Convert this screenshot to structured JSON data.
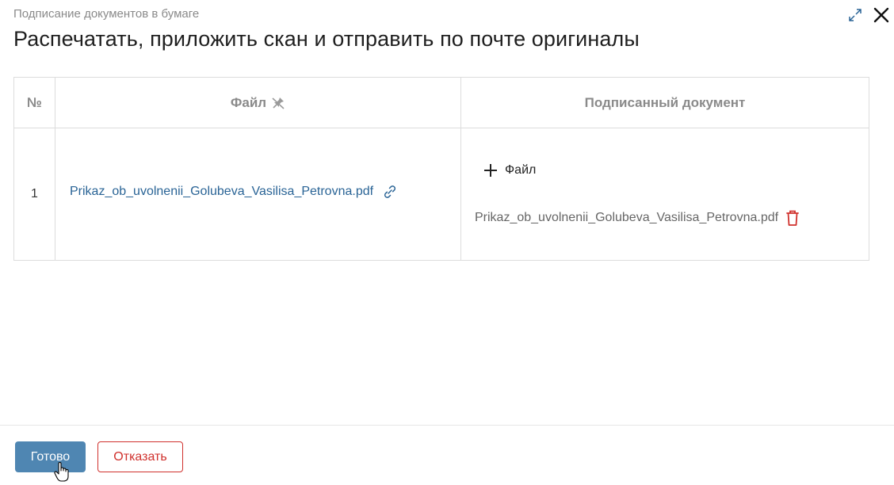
{
  "header": {
    "subtitle": "Подписание документов в бумаге",
    "title": "Распечатать, приложить скан и отправить по почте оригиналы"
  },
  "table": {
    "columns": [
      "№",
      "Файл",
      "Подписанный документ"
    ],
    "rows": [
      {
        "num": "1",
        "file": "Prikaz_ob_uvolnenii_Golubeva_Vasilisa_Petrovna.pdf",
        "add_file_label": "Файл",
        "signed_file": "Prikaz_ob_uvolnenii_Golubeva_Vasilisa_Petrovna.pdf"
      }
    ]
  },
  "footer": {
    "done_label": "Готово",
    "decline_label": "Отказать"
  },
  "colors": {
    "primary": "#4f86b2",
    "danger": "#d0312d",
    "link": "#2a6496"
  },
  "icons": [
    "expand-icon",
    "close-icon",
    "pin-off-icon",
    "link-icon",
    "plus-icon",
    "trash-icon",
    "hand-cursor-icon"
  ]
}
